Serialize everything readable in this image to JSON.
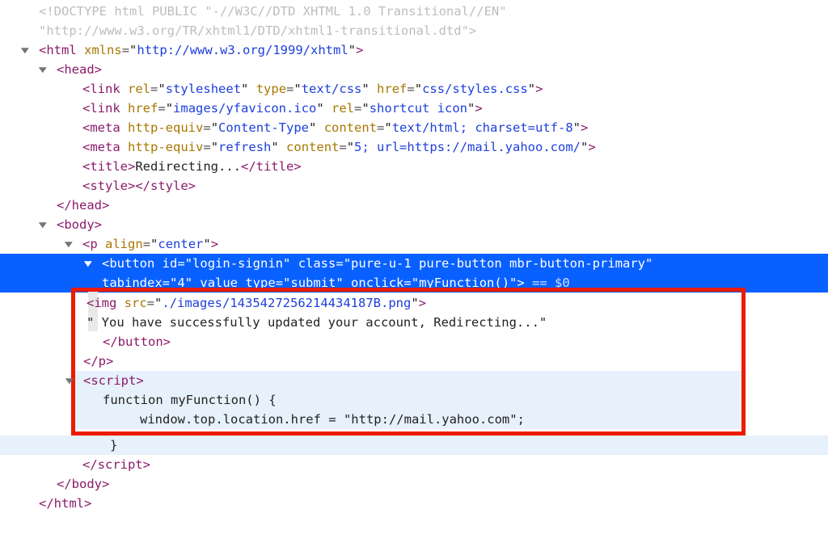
{
  "lines": {
    "doctype1": "<!DOCTYPE html PUBLIC \"-//W3C//DTD XHTML 1.0 Transitional//EN\"",
    "doctype2": "\"http://www.w3.org/TR/xhtml1/DTD/xhtml1-transitional.dtd\">",
    "html_xmlns": "http://www.w3.org/1999/xhtml",
    "link1": {
      "rel": "stylesheet",
      "type": "text/css",
      "href": "css/styles.css"
    },
    "link2": {
      "href": "images/yfavicon.ico",
      "rel": "shortcut icon"
    },
    "meta1": {
      "httpequiv": "Content-Type",
      "content": "text/html; charset=utf-8"
    },
    "meta2": {
      "httpequiv": "refresh",
      "content": "5; url=https://mail.yahoo.com/"
    },
    "title_text": "Redirecting...",
    "p_align": "center",
    "button": {
      "id": "login-signin",
      "class": "pure-u-1 pure-button mbr-button-primary",
      "tabindex": "4",
      "value_type": "submit",
      "onclick": "myFunction()",
      "after": " == $0"
    },
    "img_src": "./images/1435427256214434187B.png",
    "button_text": "\" You have successfully updated your account, Redirecting...\"",
    "script_fn": "function myFunction() {",
    "script_loc": "window.top.location.href = \"http://mail.yahoo.com\";",
    "script_brace": "}"
  }
}
